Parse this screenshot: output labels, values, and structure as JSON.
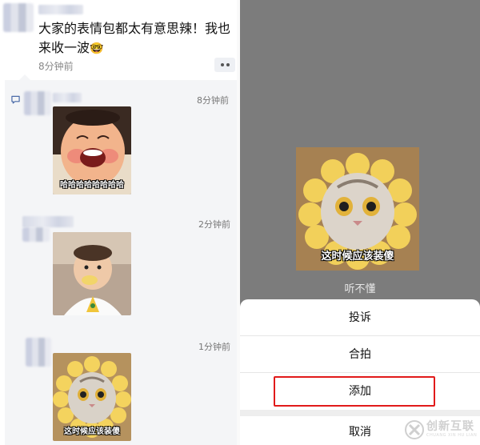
{
  "left": {
    "post": {
      "text": "大家的表情包都太有意思辣！我也来收一波",
      "emoji": "🤓",
      "time": "8分钟前"
    },
    "comments": [
      {
        "time": "8分钟前",
        "sticker_caption": "哈哈哈哈哈哈哈哈",
        "sticker": "laughing-baby"
      },
      {
        "time": "2分钟前",
        "sticker_caption": "",
        "sticker": "baby-eating"
      },
      {
        "time": "1分钟前",
        "sticker_caption": "这时候应该装傻",
        "sticker": "cat-flower"
      }
    ]
  },
  "right": {
    "sticker_caption": "这时候应该装傻",
    "sticker_label": "听不懂",
    "menu": {
      "report": "投诉",
      "collab": "合拍",
      "add": "添加",
      "cancel": "取消"
    }
  },
  "watermark": {
    "text": "创新互联",
    "sub": "CHUANG XIN HU LIAN"
  },
  "colors": {
    "highlight": "#e11a1a",
    "overlay": "#7c7c7c",
    "comment_bg": "#f4f5f7"
  }
}
